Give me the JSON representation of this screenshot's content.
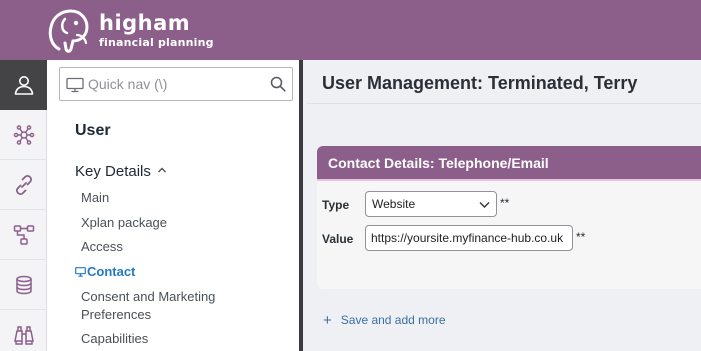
{
  "brand": {
    "name": "higham",
    "tagline": "financial planning",
    "color": "#8c5f8a"
  },
  "rail": {
    "items": [
      {
        "icon": "user-icon",
        "active": true
      },
      {
        "icon": "network-icon",
        "active": false
      },
      {
        "icon": "link-icon",
        "active": false
      },
      {
        "icon": "hierarchy-icon",
        "active": false
      },
      {
        "icon": "coins-icon",
        "active": false
      },
      {
        "icon": "binoculars-icon",
        "active": false
      }
    ]
  },
  "nav": {
    "quicknav_placeholder": "Quick nav (\\)",
    "title": "User",
    "section": "Key Details",
    "links": [
      "Main",
      "Xplan package",
      "Access",
      "Contact",
      "Consent and Marketing",
      "Preferences",
      "Capabilities"
    ],
    "active_link": "Contact"
  },
  "main": {
    "page_title": "User Management: Terminated, Terry",
    "card": {
      "title": "Contact Details: Telephone/Email",
      "type_label": "Type",
      "type_value": "Website",
      "value_label": "Value",
      "value_value": "https://yoursite.myfinance-hub.co.uk",
      "required_marker": "**"
    },
    "save_more_label": "Save and add more"
  }
}
